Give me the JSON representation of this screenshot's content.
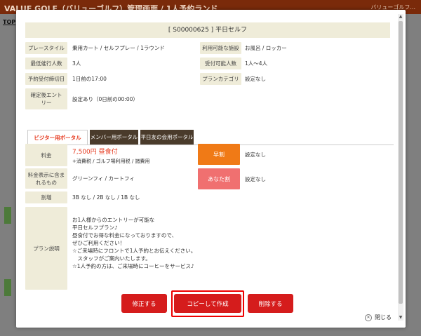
{
  "background": {
    "app_title": "VALUE GOLF（バリューゴルフ）管理画面 / 1人予約ランド",
    "header_right": "バリューゴルフ...",
    "top_link": "TOP"
  },
  "modal": {
    "plan_title": "[ S00000625 ] 平日セルフ",
    "rows": {
      "play_style_label": "プレースタイル",
      "play_style_value": "乗用カート / セルフプレー / 1ラウンド",
      "facilities_label": "利用可能な施設",
      "facilities_value": "お風呂 / ロッカー",
      "min_players_label": "最低催行人数",
      "min_players_value": "3人",
      "accept_players_label": "受付可能人数",
      "accept_players_value": "1人〜4人",
      "deadline_label": "予約受付締切日",
      "deadline_value": "1日前の17:00",
      "category_label": "プランカテゴリ",
      "category_value": "設定なし",
      "confirm_entry_label": "確定後エントリー",
      "confirm_entry_value": "設定あり（0日前の00:00）"
    },
    "tabs": [
      {
        "label": "ビジター用ポータル"
      },
      {
        "label": "メンバー用ポータル"
      },
      {
        "label": "平日友の会用ポータル"
      }
    ],
    "fee_label": "料金",
    "fee_price": "7,500円 昼食付",
    "fee_note": "+消費税 / ゴルフ場利用税 / 諸費用",
    "early_badge": "早割",
    "early_value": "設定なし",
    "included_label": "料金表示に含まれるもの",
    "included_value": "グリーンフィ / カートフィ",
    "anata_badge": "あなた割",
    "anata_value": "設定なし",
    "surcharge_label": "割増",
    "surcharge_value": "3B なし / 2B なし / 1B なし",
    "description_label": "プラン説明",
    "description_lines": [
      "お1人様からのエントリーが可能な",
      "平日セルフプラン♪",
      "",
      "昼食付でお得な料金になっておりますので、",
      "ぜひご利用ください！",
      "",
      "☆ご来場時にフロントで1人予約とお伝えください。",
      "　スタッフがご案内いたします。",
      "",
      "☆1人予約の方は、ご来場時にコーヒーをサービス♪"
    ],
    "buttons": {
      "edit": "修正する",
      "copy": "コピーして作成",
      "delete": "削除する"
    },
    "close_label": "閉じる"
  },
  "colors": {
    "beige_label": "#efecd9",
    "accent_red": "#d51c1c",
    "early_orange": "#f07a16",
    "anata_pink": "#f07070",
    "tab_dark": "#4a3b2b"
  }
}
